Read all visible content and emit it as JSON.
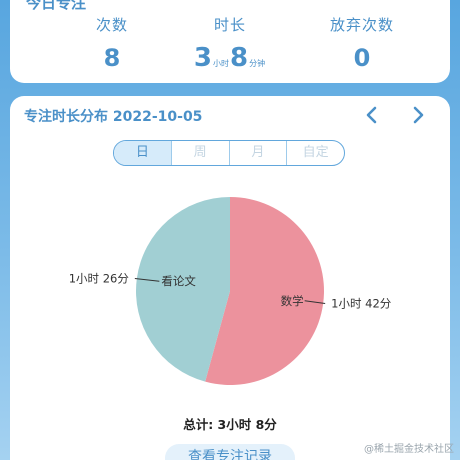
{
  "today_card": {
    "title": "今日专注",
    "stats": {
      "count_label": "次数",
      "count_value": "8",
      "duration_label": "时长",
      "duration_hours": "3",
      "duration_hours_unit": "小时",
      "duration_minutes": "8",
      "duration_minutes_unit": "分钟",
      "abandon_label": "放弃次数",
      "abandon_value": "0"
    }
  },
  "distribution": {
    "title": "专注时长分布 2022-10-05",
    "prev_icon": "chevron-left-icon",
    "next_icon": "chevron-right-icon",
    "tabs": [
      "日",
      "周",
      "月",
      "自定"
    ],
    "active_tab": "日",
    "total": "总计: 3小时 8分",
    "view_button": "查看专注记录"
  },
  "chart_data": {
    "type": "pie",
    "slices": [
      {
        "name": "数学",
        "value": 102,
        "value_label": "1小时 42分",
        "color": "#ec929d"
      },
      {
        "name": "看论文",
        "value": 86,
        "value_label": "1小时 26分",
        "color": "#a1cfd3"
      }
    ]
  },
  "watermark": "@稀土掘金技术社区"
}
